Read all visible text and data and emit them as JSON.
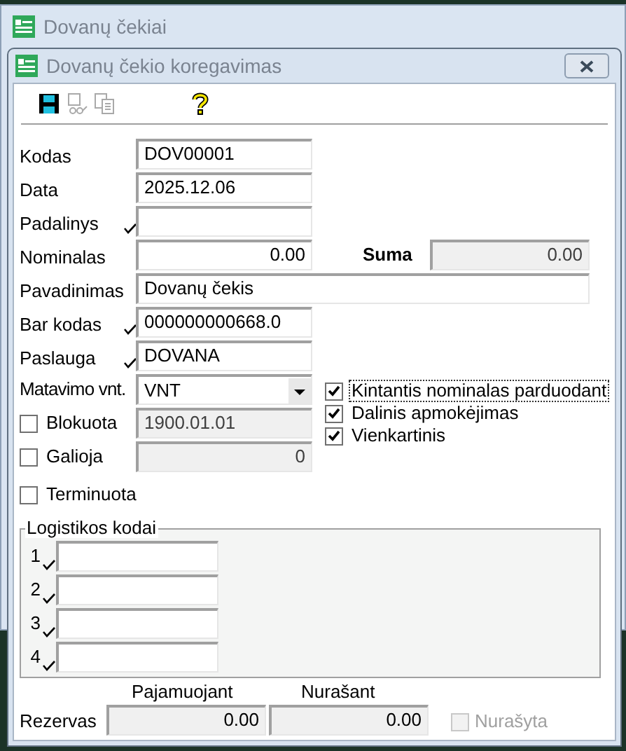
{
  "background_window": {
    "title": "Dovanų čekiai"
  },
  "dialog": {
    "title": "Dovanų čekio koregavimas",
    "toolbar": [
      {
        "kind": "save",
        "disabled": false
      },
      {
        "kind": "link",
        "disabled": true
      },
      {
        "kind": "copy",
        "disabled": true
      },
      {
        "kind": "help",
        "disabled": false
      }
    ],
    "fields": [
      {
        "label": "Kodas",
        "value": "DOV00001",
        "marked": false,
        "kind": "text"
      },
      {
        "label": "Data",
        "value": "2025.12.06",
        "marked": false,
        "kind": "text"
      },
      {
        "label": "Padalinys",
        "marked": true,
        "kind": "text"
      },
      {
        "label": "Nominalas",
        "value": "0.00",
        "marked": false,
        "kind": "number"
      },
      {
        "label": "Pavadinimas",
        "value": "Dovanų čekis",
        "marked": false,
        "kind": "wide"
      },
      {
        "label": "Bar kodas",
        "value": "000000000668.0",
        "marked": true,
        "kind": "text"
      },
      {
        "label": "Paslauga",
        "value": "DOVANA",
        "marked": true,
        "kind": "text"
      }
    ],
    "suma": {
      "label": "Suma",
      "value": "0.00"
    },
    "unit": {
      "label": "Matavimo vnt.",
      "value": "VNT"
    },
    "options": [
      {
        "label": "Blokuota",
        "checked": false,
        "value": "1900.01.01",
        "kind": "text"
      },
      {
        "label": "Galioja",
        "checked": false,
        "value": "0",
        "kind": "number"
      },
      {
        "label": "Terminuota",
        "checked": false,
        "kind": "plain"
      }
    ],
    "flags": [
      {
        "label": "Kintantis nominalas parduodant",
        "checked": true,
        "focused": true
      },
      {
        "label": "Dalinis apmokėjimas",
        "checked": true,
        "focused": false
      },
      {
        "label": "Vienkartinis",
        "checked": true,
        "focused": false
      }
    ],
    "logistics": {
      "title": "Logistikos kodai",
      "rows": [
        {
          "number": "1",
          "marked": true
        },
        {
          "number": "2",
          "marked": true
        },
        {
          "number": "3",
          "marked": true
        },
        {
          "number": "4",
          "marked": true
        }
      ]
    },
    "reserve": {
      "label": "Rezervas",
      "columns": [
        "Pajamuojant",
        "Nurašant"
      ],
      "values": [
        "0.00",
        "0.00"
      ],
      "written_off": {
        "label": "Nurašyta",
        "checked": false,
        "disabled": true
      }
    }
  }
}
